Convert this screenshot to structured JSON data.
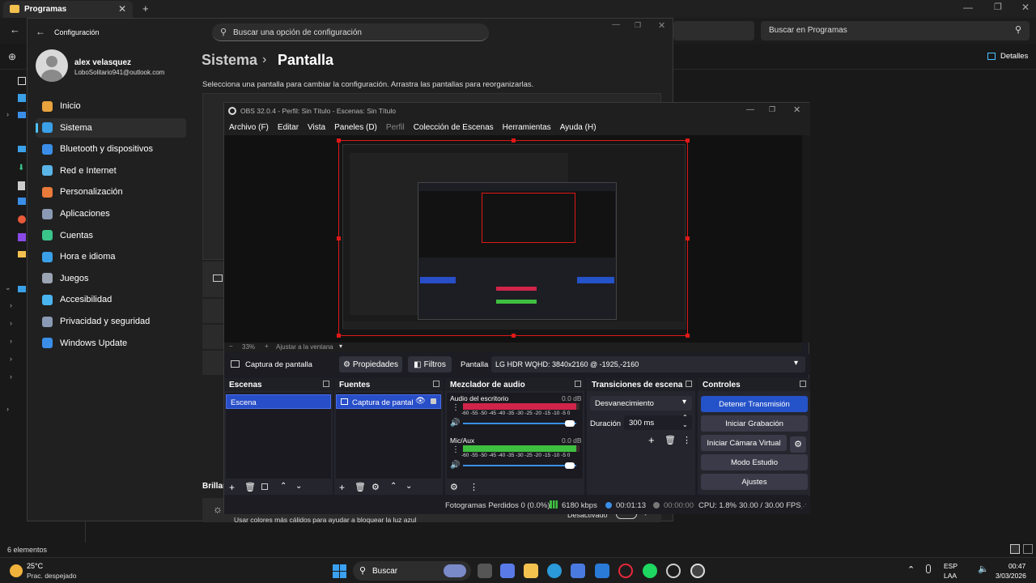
{
  "explorer": {
    "tab_title": "Programas",
    "search_placeholder": "Buscar en Programas",
    "details_label": "Detalles",
    "status_items": "6 elementos"
  },
  "settings": {
    "window_title": "Configuración",
    "search_placeholder": "Buscar una opción de configuración",
    "user_name": "alex velasquez",
    "user_email": "LoboSolitario941@outlook.com",
    "breadcrumb_parent": "Sistema",
    "breadcrumb_sep": "›",
    "breadcrumb_current": "Pantalla",
    "description": "Selecciona una pantalla para cambiar la configuración. Arrastra las pantallas para reorganizarlas.",
    "nav": [
      {
        "label": "Inicio",
        "icon": "home-icon",
        "color": "#e8a33d"
      },
      {
        "label": "Sistema",
        "icon": "system-icon",
        "color": "#3aa0e8"
      },
      {
        "label": "Bluetooth y dispositivos",
        "icon": "bluetooth-icon",
        "color": "#3a8ee8"
      },
      {
        "label": "Red e Internet",
        "icon": "network-icon",
        "color": "#5ab4e8"
      },
      {
        "label": "Personalización",
        "icon": "brush-icon",
        "color": "#e87a3a"
      },
      {
        "label": "Aplicaciones",
        "icon": "apps-icon",
        "color": "#8a9ab4"
      },
      {
        "label": "Cuentas",
        "icon": "account-icon",
        "color": "#3ac48a"
      },
      {
        "label": "Hora e idioma",
        "icon": "clock-icon",
        "color": "#3aa0e8"
      },
      {
        "label": "Juegos",
        "icon": "gamepad-icon",
        "color": "#9aa4b4"
      },
      {
        "label": "Accesibilidad",
        "icon": "accessibility-icon",
        "color": "#4ab4f0"
      },
      {
        "label": "Privacidad y seguridad",
        "icon": "shield-icon",
        "color": "#8a9ab4"
      },
      {
        "label": "Windows Update",
        "icon": "update-icon",
        "color": "#3a8ee8"
      }
    ],
    "brightness_section": "Brillan",
    "night_light_desc": "Usar colores más cálidos para ayudar a bloquear la luz azul",
    "night_light_state": "Desactivado"
  },
  "obs": {
    "title": "OBS 32.0.4 - Perfil: Sin Título - Escenas: Sin Título",
    "menu": [
      "Archivo (F)",
      "Editar",
      "Vista",
      "Paneles (D)",
      "Perfil",
      "Colección de Escenas",
      "Herramientas",
      "Ayuda (H)"
    ],
    "zoom": "33%",
    "fit_label": "Ajustar a la ventana",
    "source_name": "Captura de pantalla",
    "properties_label": "Propiedades",
    "filters_label": "Filtros",
    "display_label": "Pantalla",
    "display_value": "LG HDR WQHD: 3840x2160 @ -1925,-2160",
    "docks": {
      "scenes": "Escenas",
      "sources": "Fuentes",
      "mixer": "Mezclador de audio",
      "transitions": "Transiciones de escena",
      "controls": "Controles"
    },
    "scene_item": "Escena",
    "source_item": "Captura de pantal",
    "mixer": [
      {
        "name": "Audio del escritorio",
        "db": "0.0 dB",
        "level": 0.97,
        "meter_color": "#d0244a"
      },
      {
        "name": "Mic/Aux",
        "db": "0.0 dB",
        "level": 0.97,
        "meter_color": "#3fbf3f"
      }
    ],
    "meter_scale": "-60 -55 -50 -45 -40 -35 -30 -25 -20 -15 -10 -5 0",
    "transition": "Desvanecimiento",
    "duration_label": "Duración",
    "duration_value": "300 ms",
    "controls": [
      "Detener Transmisión",
      "Iniciar Grabación",
      "Iniciar Cámara Virtual",
      "Modo Estudio",
      "Ajustes"
    ],
    "status": {
      "dropped": "Fotogramas Perdidos 0 (0.0%)",
      "bitrate": "6180 kbps",
      "stream_time": "00:01:13",
      "rec_time": "00:00:00",
      "cpu": "CPU: 1.8%",
      "fps": "30.00 / 30.00 FPS"
    }
  },
  "taskbar": {
    "weather_temp": "25°C",
    "weather_desc": "Prac. despejado",
    "search_label": "Buscar",
    "lang_line1": "ESP",
    "lang_line2": "LAA",
    "time": "00:47",
    "date": "3/03/2026"
  },
  "colors": {
    "accent_blue": "#4cc2ff",
    "obs_selected": "#284ec8",
    "capture_border": "#e01818",
    "stream_button": "#2452c8"
  }
}
